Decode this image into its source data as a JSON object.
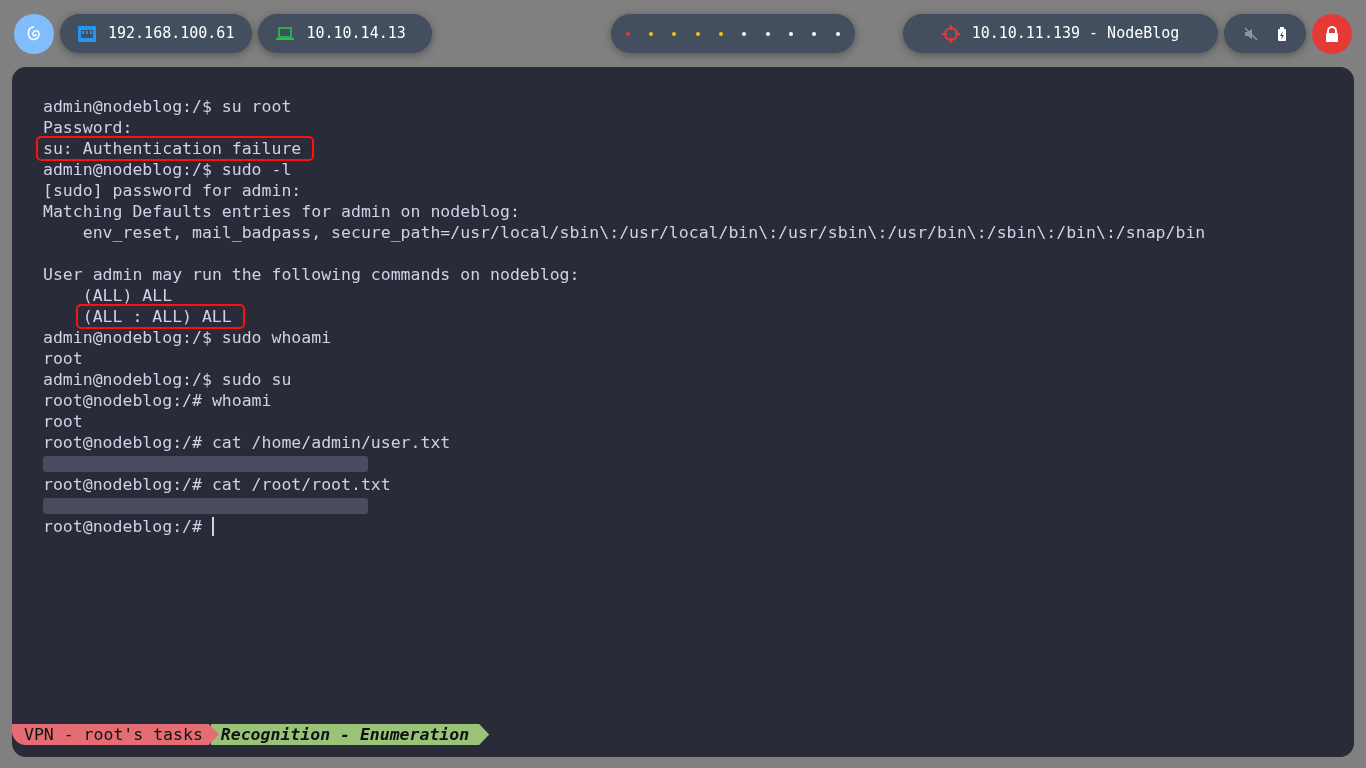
{
  "topbar": {
    "left": [
      {
        "kind": "ethernet",
        "text": "192.168.100.61"
      },
      {
        "kind": "laptop",
        "text": "10.10.14.13"
      }
    ],
    "workspaces": [
      {
        "color": "#e53935"
      },
      {
        "color": "#f5c211"
      },
      {
        "color": "#f5c211"
      },
      {
        "color": "#f5c211"
      },
      {
        "color": "#f5c211"
      },
      {
        "color": "#ffffff"
      },
      {
        "color": "#ffffff"
      },
      {
        "color": "#ffffff"
      },
      {
        "color": "#ffffff"
      },
      {
        "color": "#ffffff"
      }
    ],
    "target": {
      "text": "10.10.11.139 - NodeBlog"
    },
    "muted": true
  },
  "terminal": {
    "lines": [
      {
        "kind": "text",
        "text": "admin@nodeblog:/$ su root",
        "highlighted": false
      },
      {
        "kind": "text",
        "text": "Password:",
        "highlighted": false
      },
      {
        "kind": "text",
        "text": "su: Authentication failure",
        "highlighted": true
      },
      {
        "kind": "text",
        "text": "admin@nodeblog:/$ sudo -l",
        "highlighted": false
      },
      {
        "kind": "text",
        "text": "[sudo] password for admin:",
        "highlighted": false
      },
      {
        "kind": "text",
        "text": "Matching Defaults entries for admin on nodeblog:",
        "highlighted": false
      },
      {
        "kind": "indented",
        "text": "env_reset, mail_badpass, secure_path=/usr/local/sbin\\:/usr/local/bin\\:/usr/sbin\\:/usr/bin\\:/sbin\\:/bin\\:/snap/bin",
        "highlighted": false
      },
      {
        "kind": "blank"
      },
      {
        "kind": "text",
        "text": "User admin may run the following commands on nodeblog:",
        "highlighted": false
      },
      {
        "kind": "indented",
        "text": "(ALL) ALL",
        "highlighted": false
      },
      {
        "kind": "indented",
        "text": "(ALL : ALL) ALL",
        "highlighted": true
      },
      {
        "kind": "text",
        "text": "admin@nodeblog:/$ sudo whoami",
        "highlighted": false
      },
      {
        "kind": "text",
        "text": "root",
        "highlighted": false
      },
      {
        "kind": "text",
        "text": "admin@nodeblog:/$ sudo su",
        "highlighted": false
      },
      {
        "kind": "text",
        "text": "root@nodeblog:/# whoami",
        "highlighted": false
      },
      {
        "kind": "text",
        "text": "root",
        "highlighted": false
      },
      {
        "kind": "text",
        "text": "root@nodeblog:/# cat /home/admin/user.txt",
        "highlighted": false
      },
      {
        "kind": "redacted"
      },
      {
        "kind": "text",
        "text": "root@nodeblog:/# cat /root/root.txt",
        "highlighted": false
      },
      {
        "kind": "redacted"
      },
      {
        "kind": "prompt",
        "text": "root@nodeblog:/# "
      }
    ]
  },
  "status_bar": [
    {
      "kind": "session",
      "text": "VPN - root's tasks"
    },
    {
      "kind": "window",
      "text": "Recognition - Enumeration"
    }
  ]
}
